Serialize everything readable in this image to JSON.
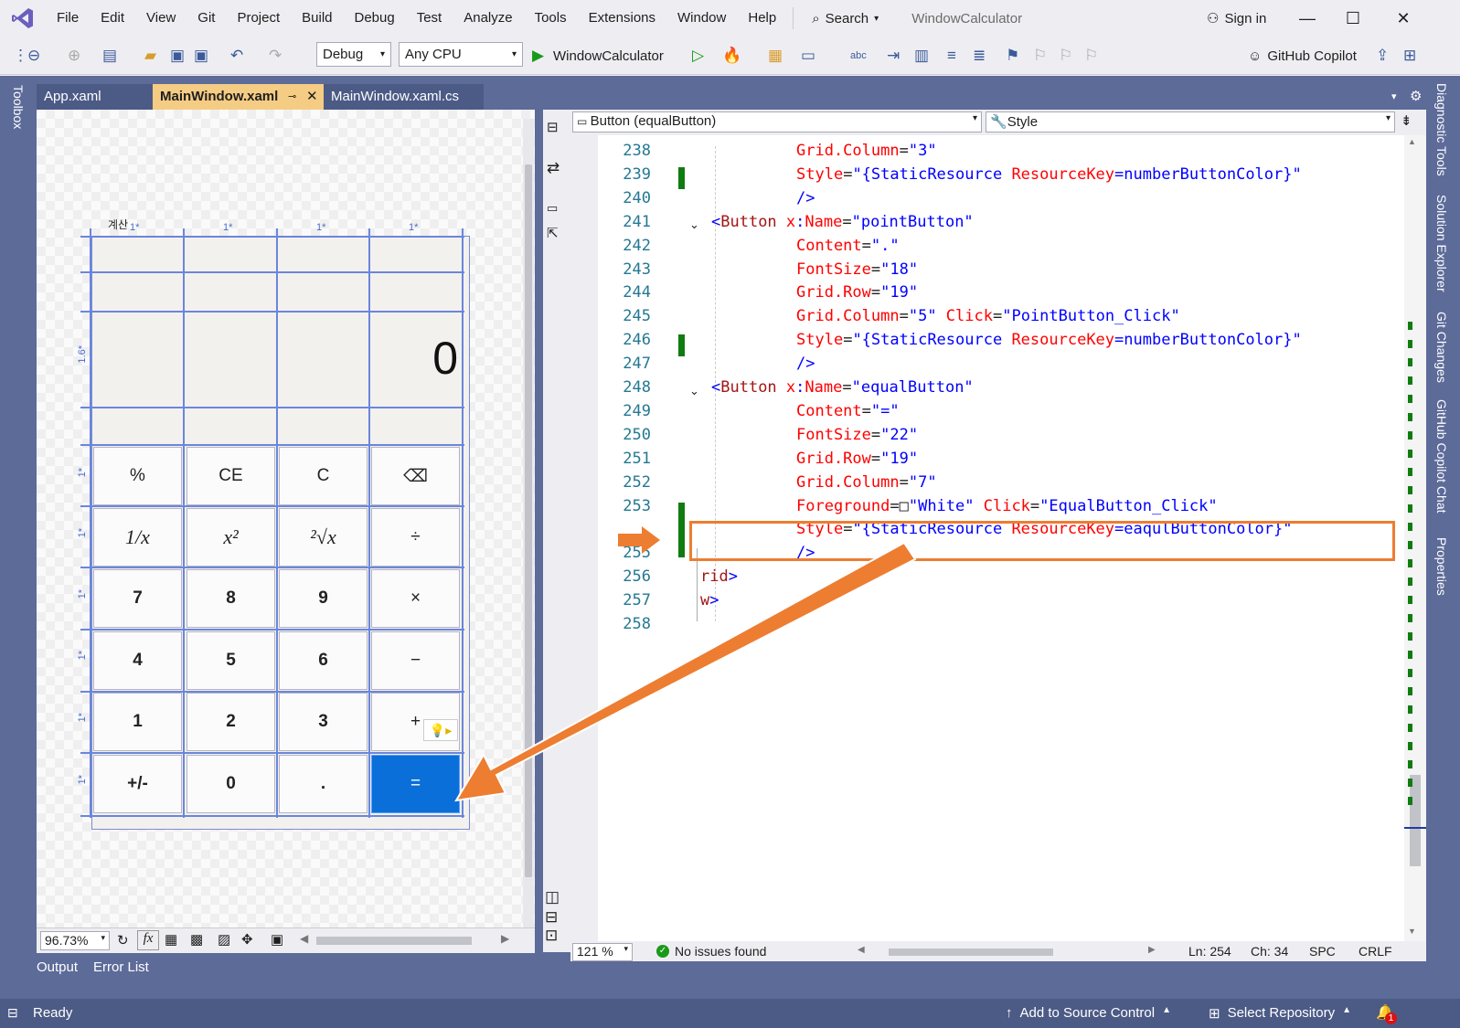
{
  "menubar": {
    "items": [
      "File",
      "Edit",
      "View",
      "Git",
      "Project",
      "Build",
      "Debug",
      "Test",
      "Analyze",
      "Tools",
      "Extensions",
      "Window",
      "Help"
    ],
    "search_label": "Search",
    "window_title": "WindowCalculator",
    "sign_in": "Sign in"
  },
  "toolbar": {
    "config": "Debug",
    "platform": "Any CPU",
    "run_target": "WindowCalculator",
    "copilot": "GitHub Copilot"
  },
  "side": {
    "toolbox": "Toolbox",
    "right_tabs": [
      "Diagnostic Tools",
      "Solution Explorer",
      "Git Changes",
      "GitHub Copilot Chat",
      "Properties"
    ]
  },
  "tabs": [
    "App.xaml",
    "MainWindow.xaml",
    "MainWindow.xaml.cs"
  ],
  "designer": {
    "display_value": "0",
    "title_fragment": "계산",
    "col_markers": [
      "1*",
      "1*",
      "1*",
      "1*"
    ],
    "row_markers": [
      "1.6*",
      "1*",
      "1*",
      "1*",
      "1*",
      "1*",
      "1*"
    ],
    "zoom": "96.73%",
    "fx": "fx",
    "buttons": [
      [
        "%",
        "CE",
        "C",
        "⌫"
      ],
      [
        "1/x",
        "x²",
        "²√x",
        "÷"
      ],
      [
        "7",
        "8",
        "9",
        "×"
      ],
      [
        "4",
        "5",
        "6",
        "−"
      ],
      [
        "1",
        "2",
        "3",
        "+"
      ],
      [
        "+/-",
        "0",
        ".",
        "="
      ]
    ]
  },
  "editor": {
    "element_combo": "Button (equalButton)",
    "property_combo": "Style",
    "lines": [
      {
        "n": "238",
        "parts": [
          [
            "t-attr",
            "Grid.Column"
          ],
          [
            "t-pl",
            "="
          ],
          [
            "t-val",
            "\"3\""
          ]
        ]
      },
      {
        "n": "239",
        "parts": [
          [
            "t-attr",
            "Style"
          ],
          [
            "t-pl",
            "="
          ],
          [
            "t-val",
            "\"{StaticResource "
          ],
          [
            "t-attr",
            "ResourceKey"
          ],
          [
            "t-val",
            "=numberButtonColor}\""
          ]
        ]
      },
      {
        "n": "240",
        "parts": [
          [
            "t-val",
            "/>"
          ]
        ]
      },
      {
        "n": "241",
        "parts": [
          [
            "t-val",
            "<"
          ],
          [
            "t-tag",
            "Button "
          ],
          [
            "t-attr",
            "x"
          ],
          [
            "t-val",
            ":"
          ],
          [
            "t-attr",
            "Name"
          ],
          [
            "t-pl",
            "="
          ],
          [
            "t-val",
            "\"pointButton\""
          ]
        ]
      },
      {
        "n": "242",
        "parts": [
          [
            "t-attr",
            "Content"
          ],
          [
            "t-pl",
            "="
          ],
          [
            "t-val",
            "\".\""
          ]
        ]
      },
      {
        "n": "243",
        "parts": [
          [
            "t-attr",
            "FontSize"
          ],
          [
            "t-pl",
            "="
          ],
          [
            "t-val",
            "\"18\""
          ]
        ]
      },
      {
        "n": "244",
        "parts": [
          [
            "t-attr",
            "Grid.Row"
          ],
          [
            "t-pl",
            "="
          ],
          [
            "t-val",
            "\"19\""
          ]
        ]
      },
      {
        "n": "245",
        "parts": [
          [
            "t-attr",
            "Grid.Column"
          ],
          [
            "t-pl",
            "="
          ],
          [
            "t-val",
            "\"5\" "
          ],
          [
            "t-attr",
            "Click"
          ],
          [
            "t-pl",
            "="
          ],
          [
            "t-val",
            "\"PointButton_Click\""
          ]
        ]
      },
      {
        "n": "246",
        "parts": [
          [
            "t-attr",
            "Style"
          ],
          [
            "t-pl",
            "="
          ],
          [
            "t-val",
            "\"{StaticResource "
          ],
          [
            "t-attr",
            "ResourceKey"
          ],
          [
            "t-val",
            "=numberButtonColor}\""
          ]
        ]
      },
      {
        "n": "247",
        "parts": [
          [
            "t-val",
            "/>"
          ]
        ]
      },
      {
        "n": "248",
        "parts": [
          [
            "t-val",
            "<"
          ],
          [
            "t-tag",
            "Button "
          ],
          [
            "t-attr",
            "x"
          ],
          [
            "t-val",
            ":"
          ],
          [
            "t-attr",
            "Name"
          ],
          [
            "t-pl",
            "="
          ],
          [
            "t-val",
            "\"equalButton\""
          ]
        ]
      },
      {
        "n": "249",
        "parts": [
          [
            "t-attr",
            "Content"
          ],
          [
            "t-pl",
            "="
          ],
          [
            "t-val",
            "\"=\""
          ]
        ]
      },
      {
        "n": "250",
        "parts": [
          [
            "t-attr",
            "FontSize"
          ],
          [
            "t-pl",
            "="
          ],
          [
            "t-val",
            "\"22\""
          ]
        ]
      },
      {
        "n": "251",
        "parts": [
          [
            "t-attr",
            "Grid.Row"
          ],
          [
            "t-pl",
            "="
          ],
          [
            "t-val",
            "\"19\""
          ]
        ]
      },
      {
        "n": "252",
        "parts": [
          [
            "t-attr",
            "Grid.Column"
          ],
          [
            "t-pl",
            "="
          ],
          [
            "t-val",
            "\"7\""
          ]
        ]
      },
      {
        "n": "253",
        "parts": [
          [
            "t-attr",
            "Foreground"
          ],
          [
            "t-pl",
            "=□"
          ],
          [
            "t-val",
            "\"White\" "
          ],
          [
            "t-attr",
            "Click"
          ],
          [
            "t-pl",
            "="
          ],
          [
            "t-val",
            "\"EqualButton_Click\""
          ]
        ]
      },
      {
        "n": "",
        "parts": [
          [
            "t-attr",
            "Style"
          ],
          [
            "t-pl",
            "="
          ],
          [
            "t-val",
            "\"{StaticResource "
          ],
          [
            "t-attr",
            "ResourceKey"
          ],
          [
            "t-val",
            "=eaqulButtonColor}\""
          ]
        ]
      },
      {
        "n": "255",
        "parts": [
          [
            "t-val",
            "/>"
          ]
        ]
      },
      {
        "n": "256",
        "parts": [
          [
            "t-tag",
            "rid"
          ],
          [
            "t-val",
            ">"
          ]
        ]
      },
      {
        "n": "257",
        "parts": [
          [
            "t-tag",
            "w"
          ],
          [
            "t-val",
            ">"
          ]
        ]
      },
      {
        "n": "258",
        "parts": []
      }
    ],
    "zoom": "121 %",
    "issues": "No issues found",
    "ln": "Ln: 254",
    "ch": "Ch: 34",
    "spc": "SPC",
    "crlf": "CRLF"
  },
  "bottom_tabs": [
    "Output",
    "Error List"
  ],
  "status": {
    "ready": "Ready",
    "source_control": "Add to Source Control",
    "repo": "Select Repository",
    "notif_count": "1"
  },
  "colors": {
    "frame": "#5d6b99",
    "active_tab": "#f5cc84",
    "equal_button": "#0a6fd8",
    "highlight": "#ed7d31",
    "change_bar": "#107c10"
  }
}
